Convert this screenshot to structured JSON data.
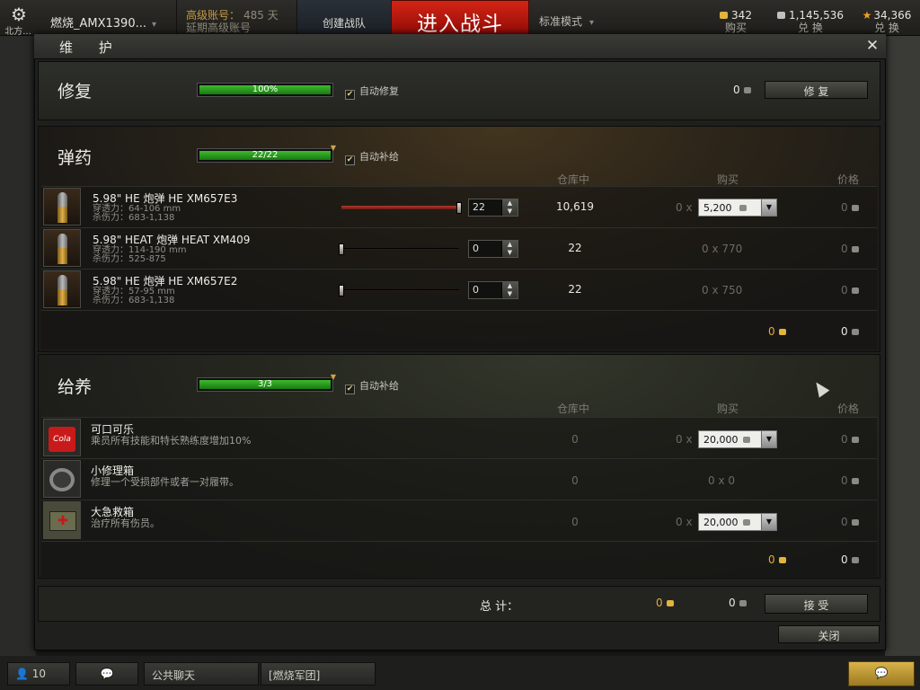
{
  "topbar": {
    "settings_label": "北方...",
    "account_name": "燃烧_AMX1390...",
    "premium_line1": "高级账号：",
    "premium_days": "485 天",
    "premium_line2": "延期高级账号",
    "create_team": "创建战队",
    "battle": "进入战斗",
    "mode": "标准模式",
    "gold_value": "342",
    "gold_label": "购买",
    "credits_value": "1,145,536",
    "credits_label": "兑 换",
    "xp_value": "34,366",
    "xp_label": "兑 换"
  },
  "dialog": {
    "title": "维  护",
    "close_label": "关闭",
    "repair": {
      "title": "修复",
      "progress_text": "100%",
      "progress": 1.0,
      "auto_label": "自动修复",
      "auto_checked": true,
      "cost": "0",
      "button": "修  复"
    },
    "ammo": {
      "title": "弹药",
      "progress_text": "22/22",
      "progress": 1.0,
      "auto_label": "自动补给",
      "auto_checked": true,
      "col_stock": "仓库中",
      "col_buy": "购买",
      "col_price": "价格",
      "items": [
        {
          "name": "5.98\" HE 炮弹 HE XM657E3",
          "pen": "穿透力：64-106 mm",
          "dmg": "杀伤力：683-1,138",
          "qty": "22",
          "slider": 1.0,
          "stock": "10,619",
          "buy_prefix": "0 x",
          "buy_value": "5,200",
          "buy_dropdown": true,
          "price": "0"
        },
        {
          "name": "5.98\" HEAT 炮弹 HEAT XM409",
          "pen": "穿透力：114-190 mm",
          "dmg": "杀伤力：525-875",
          "qty": "0",
          "slider": 0.0,
          "stock": "22",
          "buy_text": "0 x 770",
          "buy_dropdown": false,
          "price": "0"
        },
        {
          "name": "5.98\" HE 炮弹 HE XM657E2",
          "pen": "穿透力：57-95 mm",
          "dmg": "杀伤力：683-1,138",
          "qty": "0",
          "slider": 0.0,
          "stock": "22",
          "buy_text": "0 x 750",
          "buy_dropdown": false,
          "price": "0"
        }
      ],
      "total_gold": "0",
      "total_credits": "0"
    },
    "consumables": {
      "title": "给养",
      "progress_text": "3/3",
      "progress": 1.0,
      "auto_label": "自动补给",
      "auto_checked": true,
      "col_stock": "仓库中",
      "col_buy": "购买",
      "col_price": "价格",
      "items": [
        {
          "name": "可口可乐",
          "desc": "乘员所有技能和特长熟练度增加10%",
          "stock": "0",
          "buy_prefix": "0 x",
          "buy_value": "20,000",
          "buy_dropdown": true,
          "price": "0",
          "icon": "cola-icon",
          "icon_text": "Cola"
        },
        {
          "name": "小修理箱",
          "desc": "修理一个受损部件或者一对履带。",
          "stock": "0",
          "buy_text": "0 x 0",
          "buy_dropdown": false,
          "price": "0",
          "icon": "repair-kit-icon"
        },
        {
          "name": "大急救箱",
          "desc": "治疗所有伤员。",
          "stock": "0",
          "buy_prefix": "0 x",
          "buy_value": "20,000",
          "buy_dropdown": true,
          "price": "0",
          "icon": "first-aid-icon"
        }
      ],
      "total_gold": "0",
      "total_credits": "0"
    },
    "total": {
      "label": "总  计：",
      "gold": "0",
      "credits": "0",
      "accept": "接 受"
    }
  },
  "bottombar": {
    "players": "10",
    "public_chat": "公共聊天",
    "clan_chat": "[燃烧军团]"
  },
  "colors": {
    "battle_red": "#c01a10",
    "gold": "#e4ac35",
    "progress_green": "#2fa024"
  }
}
